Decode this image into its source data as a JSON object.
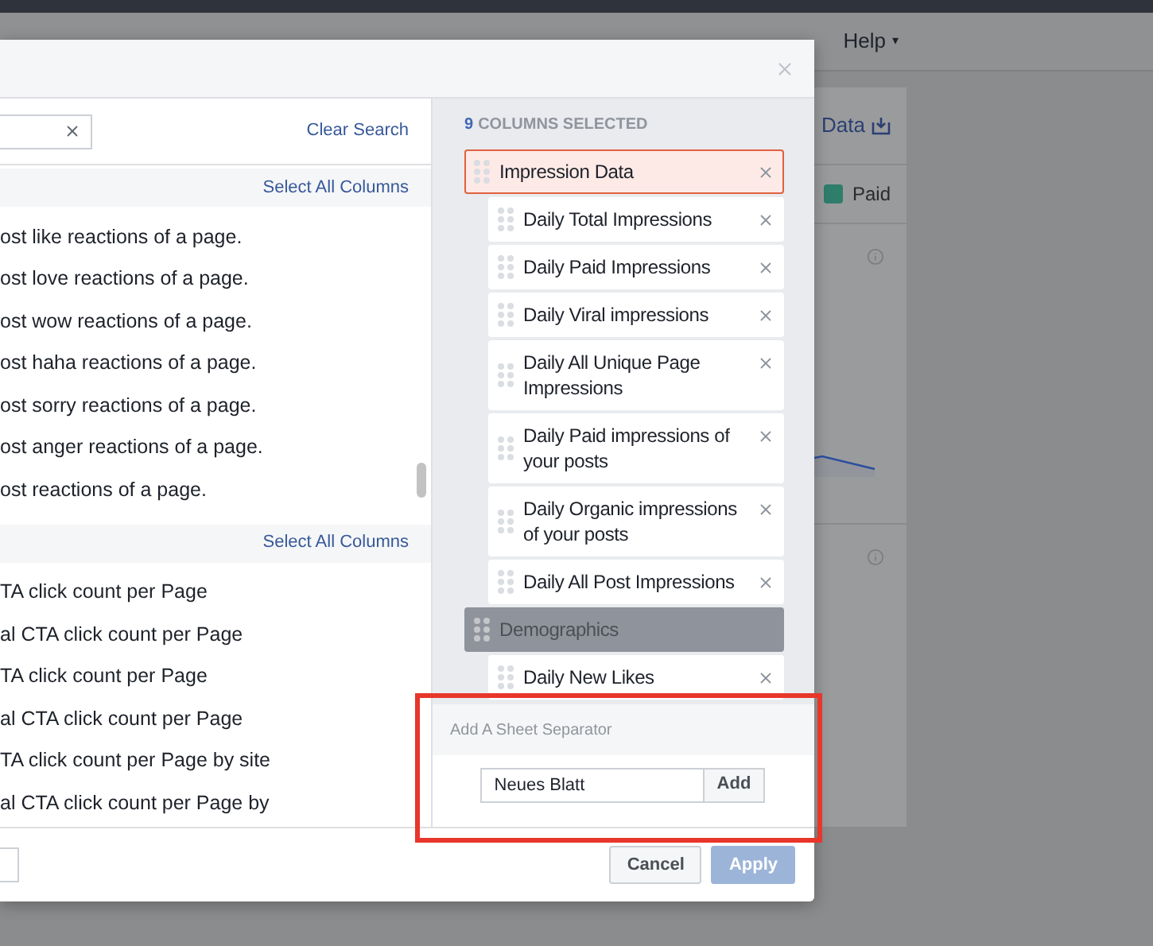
{
  "page": {
    "nav": [
      {
        "label": "Help",
        "caret": "▾"
      }
    ],
    "card": {
      "export_label": "Data",
      "legend": [
        {
          "label": "Paid",
          "color": "#2f7d6b"
        }
      ]
    }
  },
  "dialog": {
    "search": {
      "clear_label": "Clear Search"
    },
    "sections": [
      {
        "select_all": "Select All Columns",
        "items": [
          "ost like reactions of a page.",
          "ost love reactions of a page.",
          "ost wow reactions of a page.",
          "ost haha reactions of a page.",
          "ost sorry reactions of a page.",
          "ost anger reactions of a page.",
          "ost reactions of a page."
        ]
      },
      {
        "select_all": "Select All Columns",
        "items": [
          "TA click count per Page",
          "al CTA click count per Page",
          "TA click count per Page",
          "al CTA click count per Page",
          "TA click count per Page by site",
          "al CTA click count per Page by"
        ]
      }
    ],
    "selected_count": "9",
    "selected_label": "COLUMNS SELECTED",
    "columns": [
      {
        "label": "Impression Data",
        "kind": "group",
        "selected": true
      },
      {
        "label": "Daily Total Impressions",
        "kind": "column",
        "selected": false
      },
      {
        "label": "Daily Paid Impressions",
        "kind": "column",
        "selected": false
      },
      {
        "label": "Daily Viral impressions",
        "kind": "column",
        "selected": false
      },
      {
        "label": "Daily All Unique Page Impressions",
        "kind": "column",
        "selected": false
      },
      {
        "label": "Daily Paid impressions of your posts",
        "kind": "column",
        "selected": false
      },
      {
        "label": "Daily Organic impressions of your posts",
        "kind": "column",
        "selected": false
      },
      {
        "label": "Daily All Post Impressions",
        "kind": "column",
        "selected": false
      },
      {
        "label": "Demographics",
        "kind": "group",
        "selected": false
      },
      {
        "label": "Daily New Likes",
        "kind": "column",
        "selected": false
      }
    ],
    "separator": {
      "title": "Add A Sheet Separator",
      "value": "Neues Blatt",
      "add": "Add"
    },
    "buttons": [
      {
        "label": "Cancel",
        "kind": "secondary",
        "disabled": false
      },
      {
        "label": "Apply",
        "kind": "primary",
        "disabled": true
      }
    ]
  }
}
